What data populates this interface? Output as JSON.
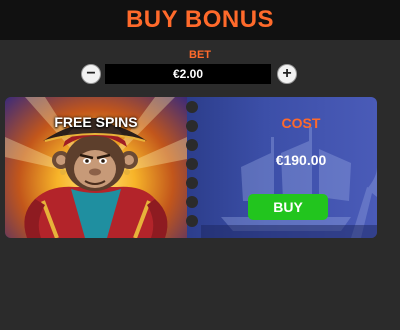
{
  "header": {
    "title": "BUY BONUS"
  },
  "bet": {
    "label": "BET",
    "value": "€2.00",
    "decrease_symbol": "−",
    "increase_symbol": "+"
  },
  "bonus": {
    "name": "FREE SPINS",
    "cost_label": "COST",
    "cost_value": "€190.00",
    "buy_label": "BUY"
  },
  "icons": {
    "decrease": "minus-icon",
    "increase": "plus-icon",
    "character": "pirate-monkey-artwork",
    "background": "pirate-ship-artwork"
  },
  "colors": {
    "accent": "#ff6a2b",
    "buy_button": "#22c51e",
    "header_bg": "#111111",
    "page_bg": "#2b2b2b",
    "card_bg": "#293a86"
  }
}
